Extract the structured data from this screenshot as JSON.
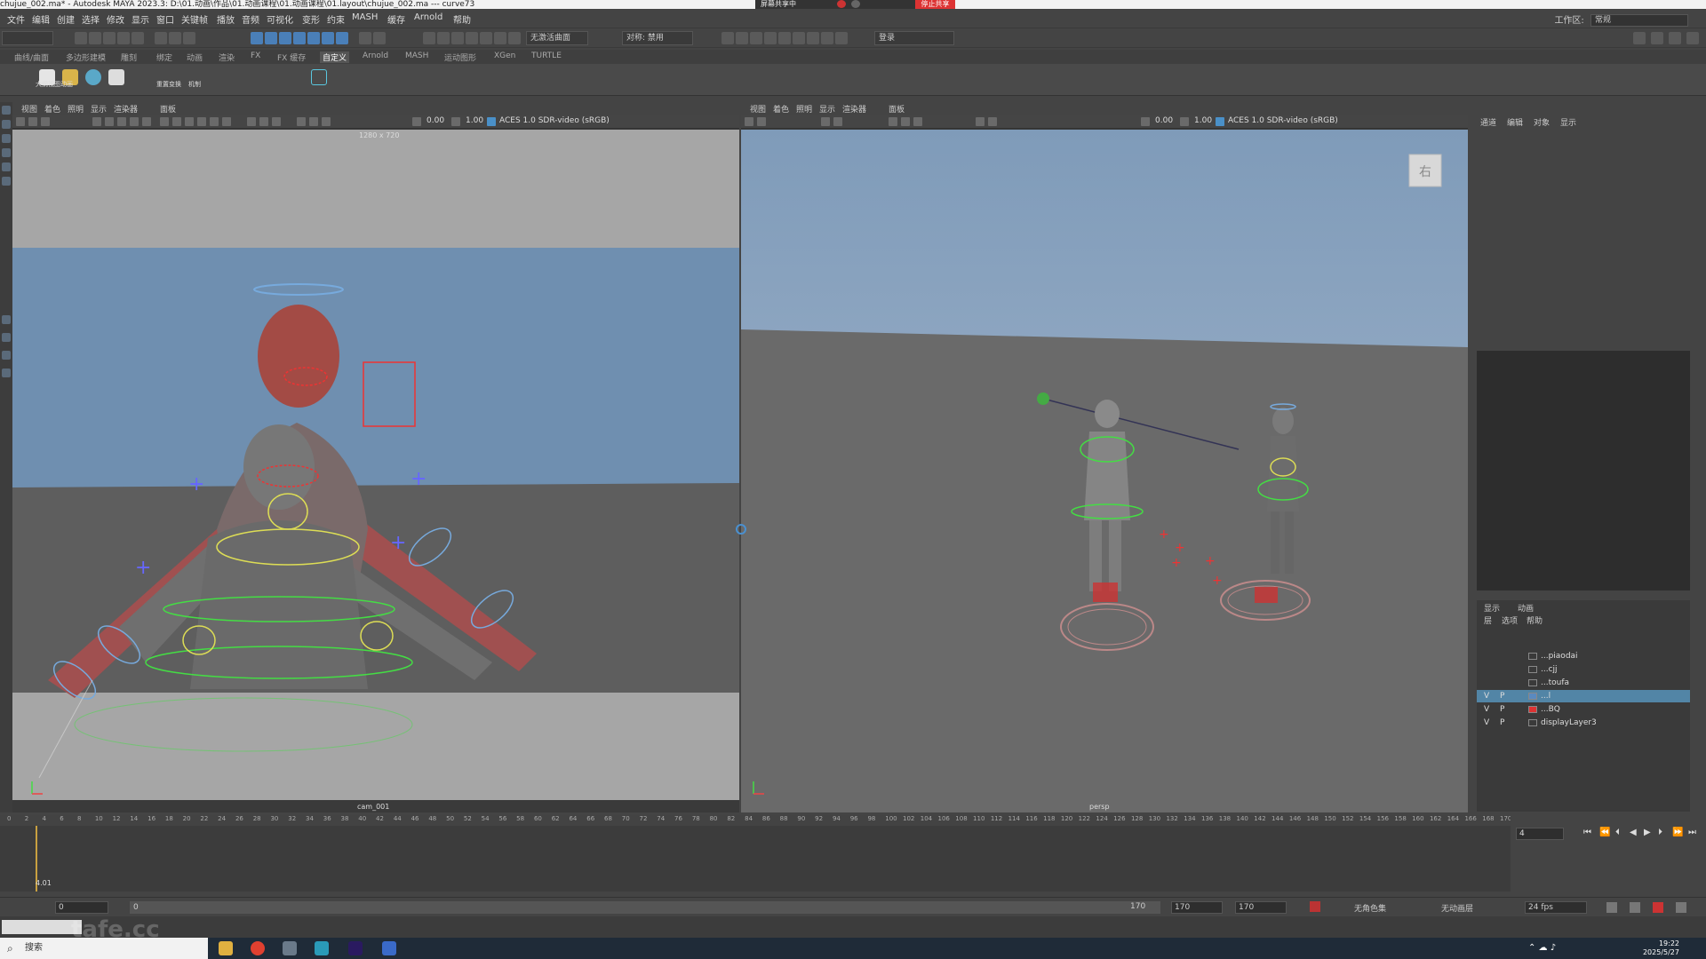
{
  "window": {
    "title": "chujue_002.ma* - Autodesk MAYA 2023.3: D:\\01.动画\\作品\\01.动画课程\\01.动画课程\\01.layout\\chujue_002.ma --- curve73",
    "screen_share_label": "屏幕共享中",
    "stop_share_label": "停止共享"
  },
  "menu": [
    "文件",
    "编辑",
    "创建",
    "选择",
    "修改",
    "显示",
    "窗口",
    "关键帧",
    "播放",
    "音频",
    "可视化",
    "变形",
    "约束",
    "MASH",
    "缓存",
    "Arnold",
    "帮助"
  ],
  "workspace": {
    "label": "工作区:",
    "value": "常规"
  },
  "statusline": {
    "live_surface": "无激活曲面",
    "symmetry": "对称: 禁用",
    "login": "登录"
  },
  "shelf_tabs": [
    "曲线/曲面",
    "多边形建模",
    "雕刻",
    "绑定",
    "动画",
    "渲染",
    "FX",
    "FX 缓存",
    "自定义",
    "Arnold",
    "MASH",
    "运动图形",
    "XGen",
    "TURTLE"
  ],
  "shelf_active_tab": "自定义",
  "shelf_labels": [
    "大纲视图",
    "动画",
    "重置变换",
    "机制"
  ],
  "left_panel": {
    "menus": [
      "视图",
      "着色",
      "照明",
      "显示",
      "渲染器",
      "面板"
    ],
    "value_a": "0.00",
    "value_b": "1.00",
    "color_space": "ACES 1.0 SDR-video (sRGB)",
    "resolution": "1280 x 720",
    "camera": "cam_001"
  },
  "right_panel": {
    "menus": [
      "视图",
      "着色",
      "照明",
      "显示",
      "渲染器",
      "面板"
    ],
    "value_a": "0.00",
    "value_b": "1.00",
    "color_space": "ACES 1.0 SDR-video (sRGB)",
    "camera": "persp",
    "viewcube": "右"
  },
  "attr_panel": {
    "menus": [
      "通道",
      "编辑",
      "对象",
      "显示"
    ]
  },
  "layer_editor": {
    "tabs": [
      "显示",
      "动画"
    ],
    "menus": [
      "层",
      "选项",
      "帮助"
    ],
    "rows": [
      {
        "v": "",
        "p": "",
        "name": "...piaodai",
        "color": "",
        "selected": false
      },
      {
        "v": "",
        "p": "",
        "name": "...cjj",
        "color": "",
        "selected": false
      },
      {
        "v": "",
        "p": "",
        "name": "...toufa",
        "color": "",
        "selected": false
      },
      {
        "v": "V",
        "p": "P",
        "name": "...l",
        "color": "#5a8ac0",
        "selected": true
      },
      {
        "v": "V",
        "p": "P",
        "name": "...BQ",
        "color": "#d33",
        "selected": false
      },
      {
        "v": "V",
        "p": "P",
        "name": "displayLayer3",
        "color": "",
        "selected": false
      }
    ]
  },
  "timeline": {
    "ticks": [
      "0",
      "2",
      "4",
      "6",
      "8",
      "10",
      "12",
      "14",
      "16",
      "18",
      "20",
      "22",
      "24",
      "26",
      "28",
      "30",
      "32",
      "34",
      "36",
      "38",
      "40",
      "42",
      "44",
      "46",
      "48",
      "50",
      "52",
      "54",
      "56",
      "58",
      "60",
      "62",
      "64",
      "66",
      "68",
      "70",
      "72",
      "74",
      "76",
      "78",
      "80",
      "82",
      "84",
      "86",
      "88",
      "90",
      "92",
      "94",
      "96",
      "98",
      "100",
      "102",
      "104",
      "106",
      "108",
      "110",
      "112",
      "114",
      "116",
      "118",
      "120",
      "122",
      "124",
      "126",
      "128",
      "130",
      "132",
      "134",
      "136",
      "138",
      "140",
      "142",
      "144",
      "146",
      "148",
      "150",
      "152",
      "154",
      "156",
      "158",
      "160",
      "162",
      "164",
      "166",
      "168",
      "170"
    ],
    "current_frame": "4",
    "key_label": "4.01"
  },
  "range": {
    "start": "0",
    "anim_start": "0",
    "end_slider": "170",
    "end": "170",
    "anim_end": "170",
    "char_set": "无角色集",
    "anim_layer": "无动画层",
    "fps": "24 fps"
  },
  "watermark": "tafe.cc",
  "taskbar": {
    "search": "搜索",
    "time": "19:22",
    "date": "2025/5/27"
  }
}
